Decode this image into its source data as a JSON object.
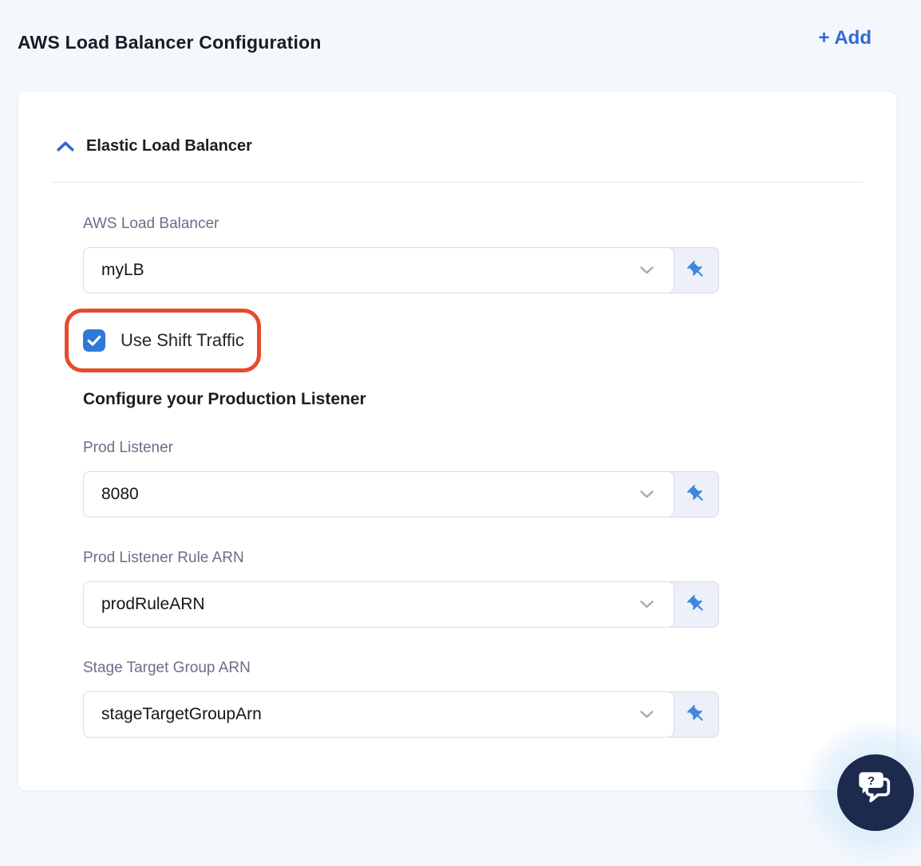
{
  "header": {
    "title": "AWS Load Balancer Configuration",
    "add_label": "+ Add"
  },
  "panel": {
    "section_title": "Elastic Load Balancer",
    "fields": {
      "aws_load_balancer": {
        "label": "AWS Load Balancer",
        "value": "myLB"
      },
      "prod_listener": {
        "label": "Prod Listener",
        "value": "8080"
      },
      "prod_listener_rule_arn": {
        "label": "Prod Listener Rule ARN",
        "value": "prodRuleARN"
      },
      "stage_target_group_arn": {
        "label": "Stage Target Group ARN",
        "value": "stageTargetGroupArn"
      }
    },
    "use_shift_traffic": {
      "label": "Use Shift Traffic",
      "checked": true
    },
    "production_listener_heading": "Configure your Production Listener"
  },
  "icons": {
    "section_collapse": "chevron-up-icon",
    "dropdown": "chevron-down-icon",
    "pin": "pushpin-icon",
    "checkbox_check": "check-icon",
    "help": "chat-question-icon"
  },
  "annotations": {
    "use_shift_traffic_highlight": "red-rounded-box"
  },
  "colors": {
    "page_bg": "#f4f8fd",
    "card_bg": "#ffffff",
    "accent_blue": "#3169d5",
    "checkbox_blue": "#2f78d6",
    "pin_blue": "#3f86e2",
    "highlight_red": "#e84a2d",
    "label_gray": "#6b6e87",
    "help_navy": "#1b2a4d"
  }
}
